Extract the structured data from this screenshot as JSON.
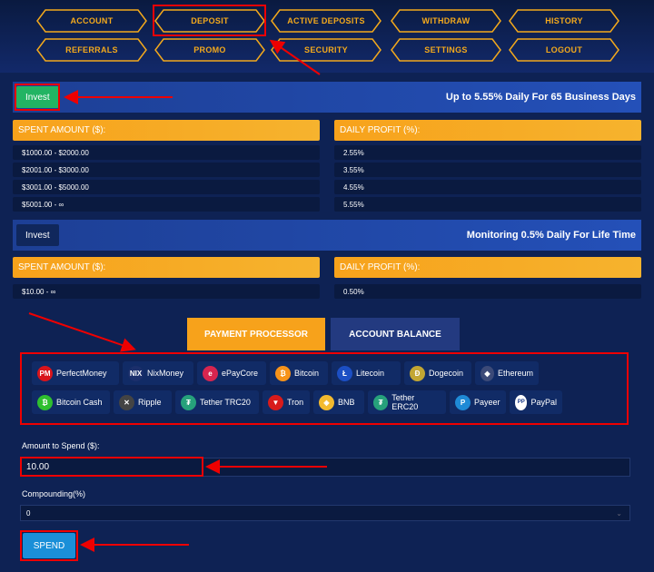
{
  "nav": [
    "ACCOUNT",
    "DEPOSIT",
    "ACTIVE DEPOSITS",
    "WITHDRAW",
    "HISTORY",
    "REFERRALS",
    "PROMO",
    "SECURITY",
    "SETTINGS",
    "LOGOUT"
  ],
  "plans": [
    {
      "button": "Invest",
      "title": "Up to 5.55% Daily For 65 Business Days",
      "col1": "SPENT AMOUNT ($):",
      "col2": "DAILY PROFIT (%):",
      "rows": [
        [
          "$1000.00 - $2000.00",
          "2.55%"
        ],
        [
          "$2001.00 - $3000.00",
          "3.55%"
        ],
        [
          "$3001.00 - $5000.00",
          "4.55%"
        ],
        [
          "$5001.00 - ∞",
          "5.55%"
        ]
      ]
    },
    {
      "button": "Invest",
      "title": "Monitoring 0.5% Daily For Life Time",
      "col1": "SPENT AMOUNT ($):",
      "col2": "DAILY PROFIT (%):",
      "rows": [
        [
          "$10.00 - ∞",
          "0.50%"
        ]
      ]
    }
  ],
  "tabs": [
    "PAYMENT PROCESSOR",
    "ACCOUNT BALANCE"
  ],
  "processors": [
    {
      "name": "PerfectMoney",
      "icon": "PM",
      "color": "#d9141b"
    },
    {
      "name": "NixMoney",
      "icon": "NIX",
      "color": "#1b2f6b"
    },
    {
      "name": "ePayCore",
      "icon": "e",
      "color": "#d8254f"
    },
    {
      "name": "Bitcoin",
      "icon": "₿",
      "color": "#f7931a"
    },
    {
      "name": "Litecoin",
      "icon": "Ł",
      "color": "#1c4fc4"
    },
    {
      "name": "Dogecoin",
      "icon": "Ð",
      "color": "#c2a633"
    },
    {
      "name": "Ethereum",
      "icon": "◆",
      "color": "#3c4a78"
    },
    {
      "name": "Bitcoin Cash",
      "icon": "₿",
      "color": "#2fbf2f"
    },
    {
      "name": "Ripple",
      "icon": "✕",
      "color": "#444"
    },
    {
      "name": "Tether TRC20",
      "icon": "₮",
      "color": "#26a17b"
    },
    {
      "name": "Tron",
      "icon": "▼",
      "color": "#d81b1b"
    },
    {
      "name": "BNB",
      "icon": "◈",
      "color": "#f3ba2f"
    },
    {
      "name": "Tether ERC20",
      "icon": "₮",
      "color": "#26a17b"
    },
    {
      "name": "Payeer",
      "icon": "P",
      "color": "#1f8ad6"
    },
    {
      "name": "PayPal",
      "icon": "PP",
      "color": "#ffffff"
    }
  ],
  "form": {
    "amount_label": "Amount to Spend ($):",
    "amount_value": "10.00",
    "compound_label": "Compounding(%)",
    "compound_value": "0",
    "spend": "SPEND"
  },
  "colors": {
    "accent": "#f7a21b",
    "invest_green": "#22b463",
    "spend_blue": "#1a8fd8",
    "annotation": "#e00000"
  }
}
